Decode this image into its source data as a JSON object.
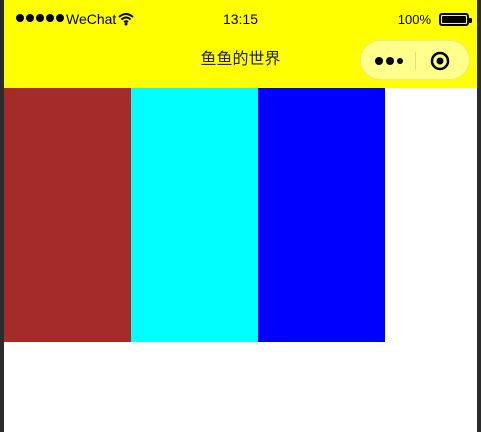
{
  "status_bar": {
    "carrier": "WeChat",
    "time": "13:15",
    "battery": "100%"
  },
  "nav": {
    "title": "鱼鱼的世界"
  },
  "blocks": [
    {
      "name": "brown",
      "color": "#a52a2a"
    },
    {
      "name": "cyan",
      "color": "#00ffff"
    },
    {
      "name": "blue",
      "color": "#0000ff"
    }
  ],
  "colors": {
    "bar": "#ffff00",
    "background": "#ffffff"
  }
}
